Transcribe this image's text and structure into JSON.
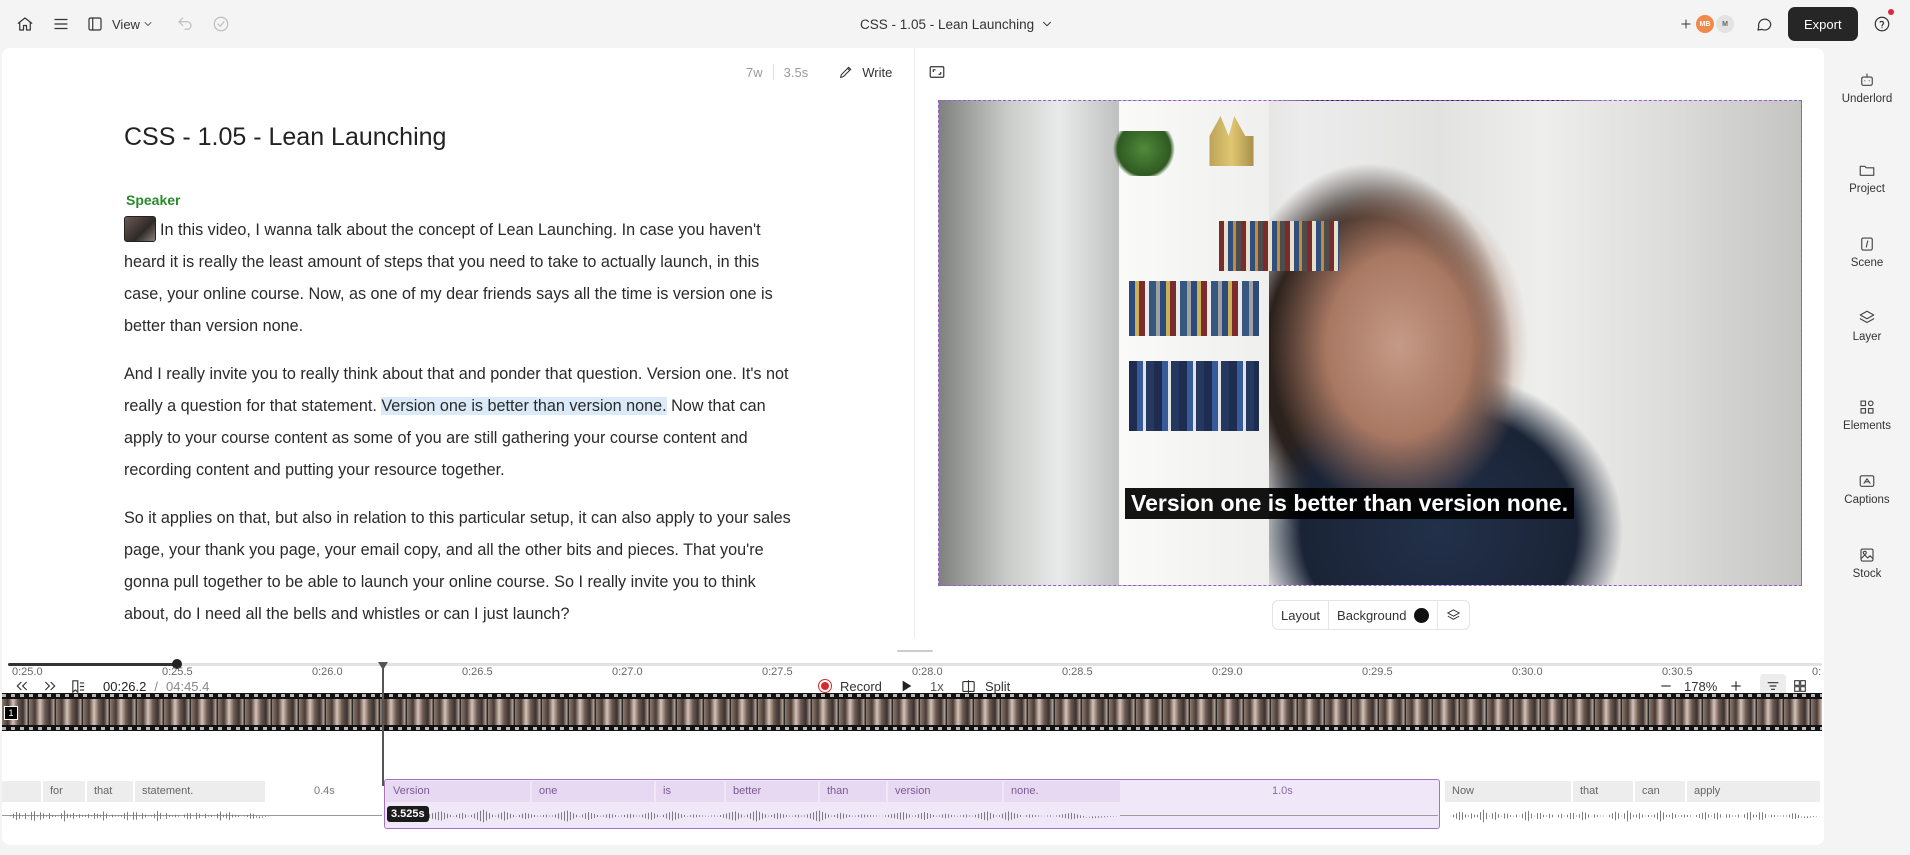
{
  "topbar": {
    "view_label": "View",
    "doc_title": "CSS - 1.05 - Lean Launching",
    "avatars": [
      {
        "initials": "MB",
        "color": "#f08a4b"
      },
      {
        "initials": "M",
        "color": "#d9d9d9"
      }
    ],
    "export_label": "Export"
  },
  "script": {
    "word_count": "7w",
    "duration": "3.5s",
    "write_label": "Write",
    "title": "CSS - 1.05 - Lean Launching",
    "speaker": "Speaker",
    "p1": "In this video, I wanna talk about the concept of Lean Launching. In case you haven't heard it is really the least amount of steps that you need to take to actually launch, in this case, your online course. Now, as one of my dear friends says all the time is version one is better than version none.",
    "p2_before": "And I really invite you to really think about that and ponder that question. Version one. It's not really a question for that statement. ",
    "p2_highlight": "Version one is better than version none.",
    "p2_after": " Now that can apply to your course content as some of you are still gathering your course content and recording content and putting your resource together.",
    "p3": "So it applies on that, but also in relation to this particular setup, it can also apply to your sales page, your thank you page, your email copy, and all the other bits and pieces. That you're gonna pull together to be able to launch your online course. So I really invite you to think about, do I need all the bells and whistles or can I just launch?"
  },
  "video": {
    "caption": "Version one is better than version none.",
    "layout_label": "Layout",
    "background_label": "Background",
    "background_color": "#111111"
  },
  "playback": {
    "progress_fraction": 0.093,
    "current_time": "00:26.2",
    "separator": "/",
    "total_time": "04:45.4",
    "record_label": "Record",
    "speed": "1x",
    "split_label": "Split",
    "zoom": "178%"
  },
  "timeline": {
    "ticks": [
      "0:25.0",
      "0:25.5",
      "0:26.0",
      "0:26.5",
      "0:27.0",
      "0:27.5",
      "0:28.0",
      "0:28.5",
      "0:29.0",
      "0:29.5",
      "0:30.0",
      "0:30.5",
      "0:"
    ],
    "clip_number": "1",
    "words_before": [
      "for",
      "that",
      "statement."
    ],
    "gap_before": "0.4s",
    "selected_words": [
      "Version",
      "one",
      "is",
      "better",
      "than",
      "version",
      "none."
    ],
    "gap_selected": "1.0s",
    "selection_duration": "3.525s",
    "words_after": [
      "Now",
      "that",
      "can",
      "apply"
    ]
  },
  "rail": {
    "items": [
      "Underlord",
      "Project",
      "Scene",
      "Layer",
      "Elements",
      "Captions",
      "Stock"
    ]
  }
}
